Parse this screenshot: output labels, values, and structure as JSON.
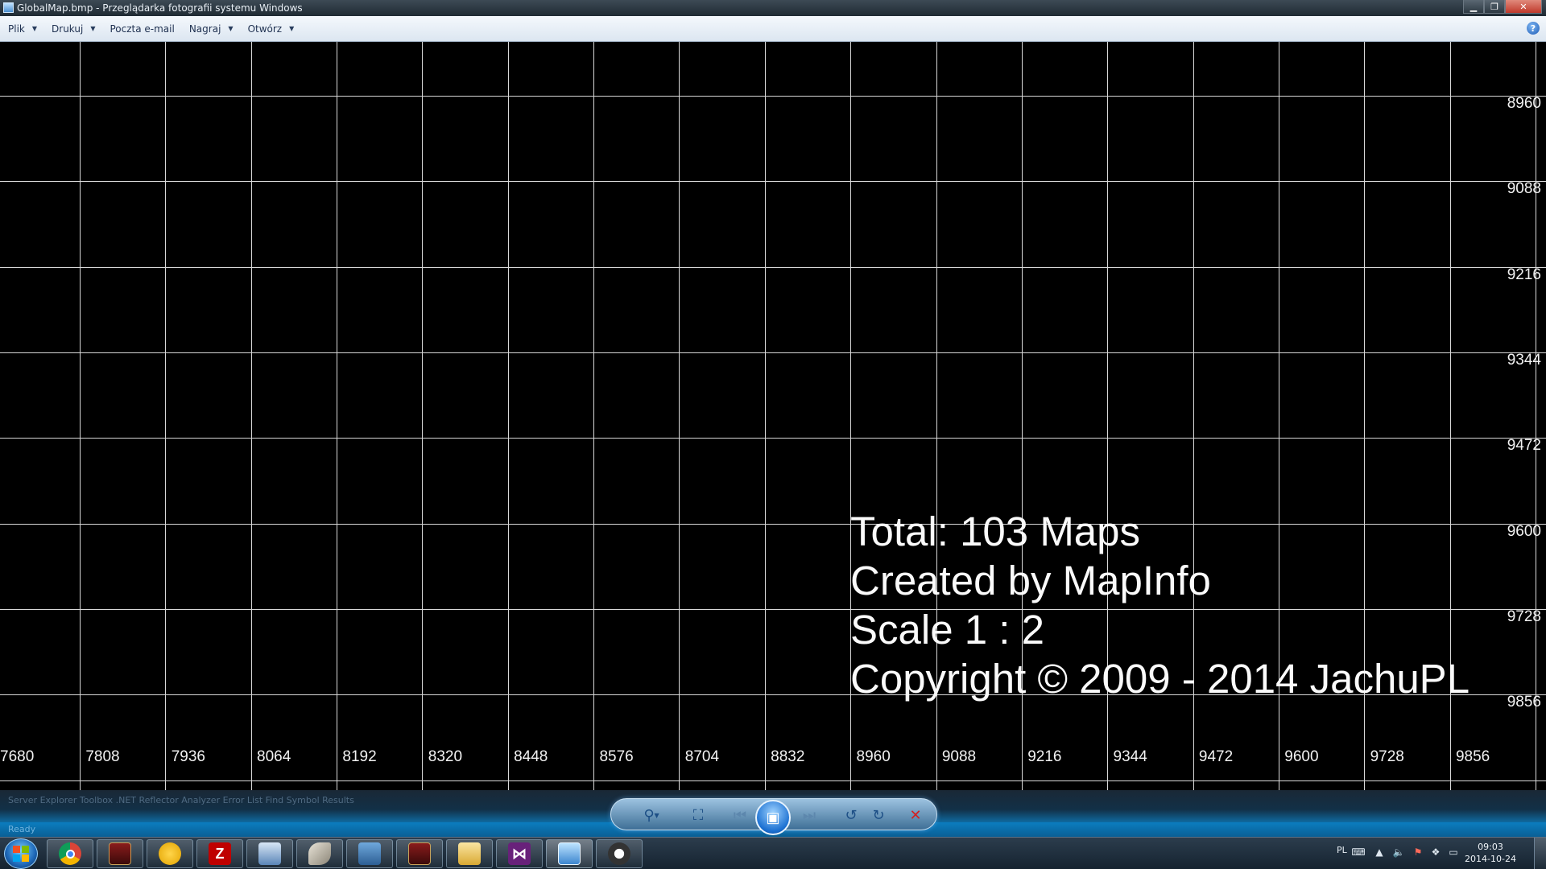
{
  "window": {
    "title": "GlobalMap.bmp - Przeglądarka fotografii systemu Windows"
  },
  "menu": [
    {
      "label": "Plik",
      "has_dropdown": true
    },
    {
      "label": "Drukuj",
      "has_dropdown": true
    },
    {
      "label": "Poczta e-mail",
      "has_dropdown": false
    },
    {
      "label": "Nagraj",
      "has_dropdown": true
    },
    {
      "label": "Otwórz",
      "has_dropdown": true
    }
  ],
  "map": {
    "x_labels": [
      "7680",
      "7808",
      "7936",
      "8064",
      "8192",
      "8320",
      "8448",
      "8576",
      "8704",
      "8832",
      "8960",
      "9088",
      "9216",
      "9344",
      "9472",
      "9600",
      "9728",
      "9856"
    ],
    "y_labels": [
      "8960",
      "9088",
      "9216",
      "9344",
      "9472",
      "9600",
      "9728",
      "9856"
    ],
    "info_lines": [
      "Total: 103 Maps",
      "Created by MapInfo",
      "Scale 1 : 2",
      "Copyright © 2009 - 2014 JachuPL"
    ],
    "colors": {
      "background": "#000000",
      "grid": "#d8d8d8",
      "text": "#ffffff"
    }
  },
  "background_strip": {
    "tabs_text": "Server Explorer   Toolbox        .NET Reflector Analyzer   Error List   Find Symbol Results",
    "status_text": "Ready"
  },
  "viewer_controls": [
    {
      "name": "zoom",
      "icon": "magnifier-icon"
    },
    {
      "name": "actual-size",
      "icon": "fit-window-icon"
    },
    {
      "name": "previous",
      "icon": "previous-icon"
    },
    {
      "name": "slideshow",
      "icon": "slideshow-icon"
    },
    {
      "name": "next",
      "icon": "next-icon"
    },
    {
      "name": "rotate-left",
      "icon": "rotate-ccw-icon"
    },
    {
      "name": "rotate-right",
      "icon": "rotate-cw-icon"
    },
    {
      "name": "delete",
      "icon": "delete-icon"
    }
  ],
  "taskbar": {
    "apps": [
      {
        "name": "chrome",
        "icon": "chrome-icon"
      },
      {
        "name": "game-1",
        "icon": "game-icon"
      },
      {
        "name": "bee",
        "icon": "bee-icon"
      },
      {
        "name": "filezilla",
        "icon": "filezilla-icon",
        "glyph": "Z"
      },
      {
        "name": "network-tool",
        "icon": "network-icon"
      },
      {
        "name": "feather-tool",
        "icon": "feather-icon"
      },
      {
        "name": "remote-desktop",
        "icon": "remote-desktop-icon"
      },
      {
        "name": "game-2",
        "icon": "game-icon"
      },
      {
        "name": "explorer",
        "icon": "folder-icon"
      },
      {
        "name": "visual-studio",
        "icon": "visual-studio-icon"
      },
      {
        "name": "photo-viewer",
        "icon": "photo-viewer-icon"
      },
      {
        "name": "lemur-tool",
        "icon": "lemur-icon"
      }
    ],
    "tray": {
      "language": "PL",
      "time": "09:03",
      "date": "2014-10-24"
    }
  }
}
